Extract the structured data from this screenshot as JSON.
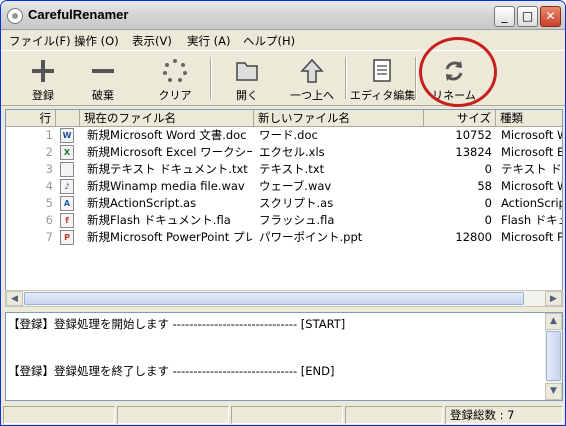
{
  "window": {
    "title": "CarefulRenamer"
  },
  "title_buttons": {
    "minimize": "_",
    "maximize": "□",
    "close": "✕"
  },
  "menu": [
    "ファイル(F)",
    "操作 (O)",
    "表示(V)",
    "実行 (A)",
    "ヘルプ(H)"
  ],
  "toolbar": [
    {
      "label": "登録",
      "icon": "plus-icon"
    },
    {
      "label": "破棄",
      "icon": "minus-icon"
    },
    {
      "label": "クリア",
      "icon": "clear-icon"
    },
    {
      "label": "開く",
      "icon": "folder-icon"
    },
    {
      "label": "一つ上へ",
      "icon": "up-arrow-icon"
    },
    {
      "label": "エディタ編集",
      "icon": "editor-icon"
    },
    {
      "label": "リネーム",
      "icon": "rename-icon"
    }
  ],
  "columns": {
    "num": "行",
    "current": "現在のファイル名",
    "new": "新しいファイル名",
    "size": "サイズ",
    "type": "種類"
  },
  "files": [
    {
      "num": "1",
      "icon": "W",
      "icon_color": "#1e4e9c",
      "current": "新規Microsoft Word 文書.doc",
      "new": "ワード.doc",
      "size": "10752",
      "type": "Microsoft W"
    },
    {
      "num": "2",
      "icon": "X",
      "icon_color": "#1d7a2e",
      "current": "新規Microsoft Excel ワークシー...",
      "new": "エクセル.xls",
      "size": "13824",
      "type": "Microsoft E"
    },
    {
      "num": "3",
      "icon": "",
      "icon_color": "#555555",
      "current": "新規テキスト ドキュメント.txt",
      "new": "テキスト.txt",
      "size": "0",
      "type": "テキスト ドキ"
    },
    {
      "num": "4",
      "icon": "♪",
      "icon_color": "#1e3e9c",
      "current": "新規Winamp media file.wav",
      "new": "ウェーブ.wav",
      "size": "58",
      "type": "Microsoft W"
    },
    {
      "num": "5",
      "icon": "A",
      "icon_color": "#2a5aa8",
      "current": "新規ActionScript.as",
      "new": "スクリプト.as",
      "size": "0",
      "type": "ActionScript"
    },
    {
      "num": "6",
      "icon": "f",
      "icon_color": "#c0392b",
      "current": "新規Flash ドキュメント.fla",
      "new": "フラッシュ.fla",
      "size": "0",
      "type": "Flash ドキュ"
    },
    {
      "num": "7",
      "icon": "P",
      "icon_color": "#c0392b",
      "current": "新規Microsoft PowerPoint プレ...",
      "new": "パワーポイント.ppt",
      "size": "12800",
      "type": "Microsoft Po"
    }
  ],
  "log": {
    "line1": "【登録】登録処理を開始します ------------------------------ [START]",
    "line2": "【登録】登録処理を終了します ------------------------------ [END]"
  },
  "status": {
    "count": "登録総数 : 7"
  }
}
